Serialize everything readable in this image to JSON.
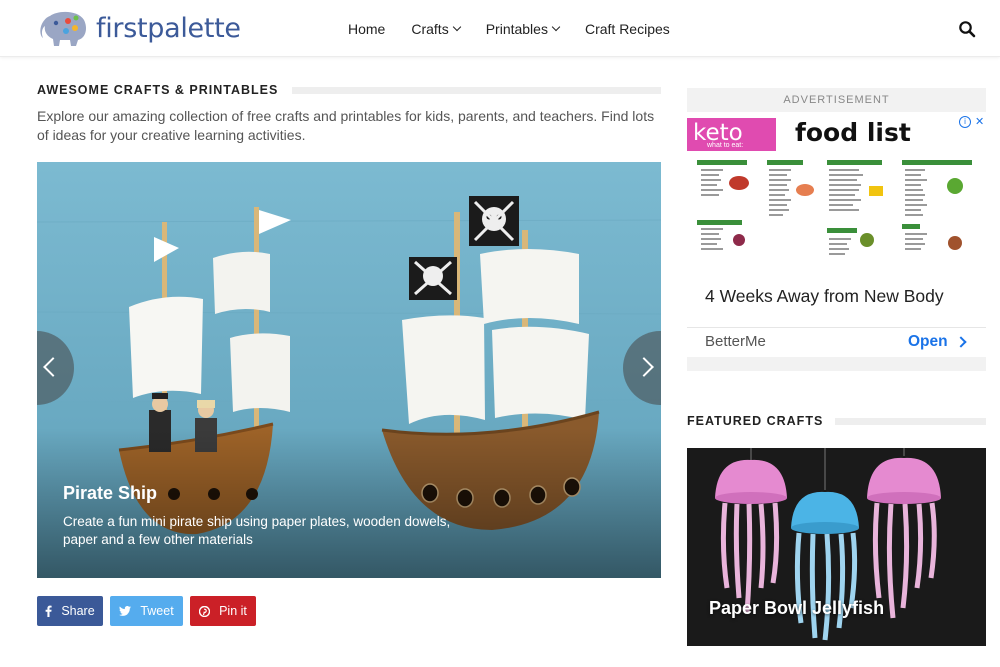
{
  "site": {
    "logo_text": "firstpalette",
    "brand_color": "#3c5a99"
  },
  "nav": {
    "items": [
      {
        "label": "Home",
        "dropdown": false
      },
      {
        "label": "Crafts",
        "dropdown": true
      },
      {
        "label": "Printables",
        "dropdown": true
      },
      {
        "label": "Craft Recipes",
        "dropdown": false
      }
    ],
    "search_icon": "search-icon"
  },
  "main": {
    "section_title": "AWESOME CRAFTS & PRINTABLES",
    "intro": "Explore our amazing collection of free crafts and printables for kids, parents, and teachers. Find lots of ideas for your creative learning activities.",
    "slide": {
      "title": "Pirate Ship",
      "description": "Create a fun mini pirate ship using paper plates, wooden dowels, paper and a few other materials"
    },
    "share": {
      "facebook": "Share",
      "twitter": "Tweet",
      "pinterest": "Pin it"
    }
  },
  "sidebar": {
    "ad": {
      "label": "ADVERTISEMENT",
      "banner_keto": "keto",
      "banner_sub": "what to eat:",
      "banner_title": "food list",
      "headline": "4 Weeks Away from New Body",
      "brand": "BetterMe",
      "cta": "Open"
    },
    "featured": {
      "title": "FEATURED CRAFTS",
      "item_label": "Paper Bowl Jellyfish"
    }
  },
  "colors": {
    "facebook": "#3b5998",
    "twitter": "#55acee",
    "pinterest": "#cb2027",
    "ad_link": "#1a73e8",
    "keto_pink": "#e04bb0"
  }
}
